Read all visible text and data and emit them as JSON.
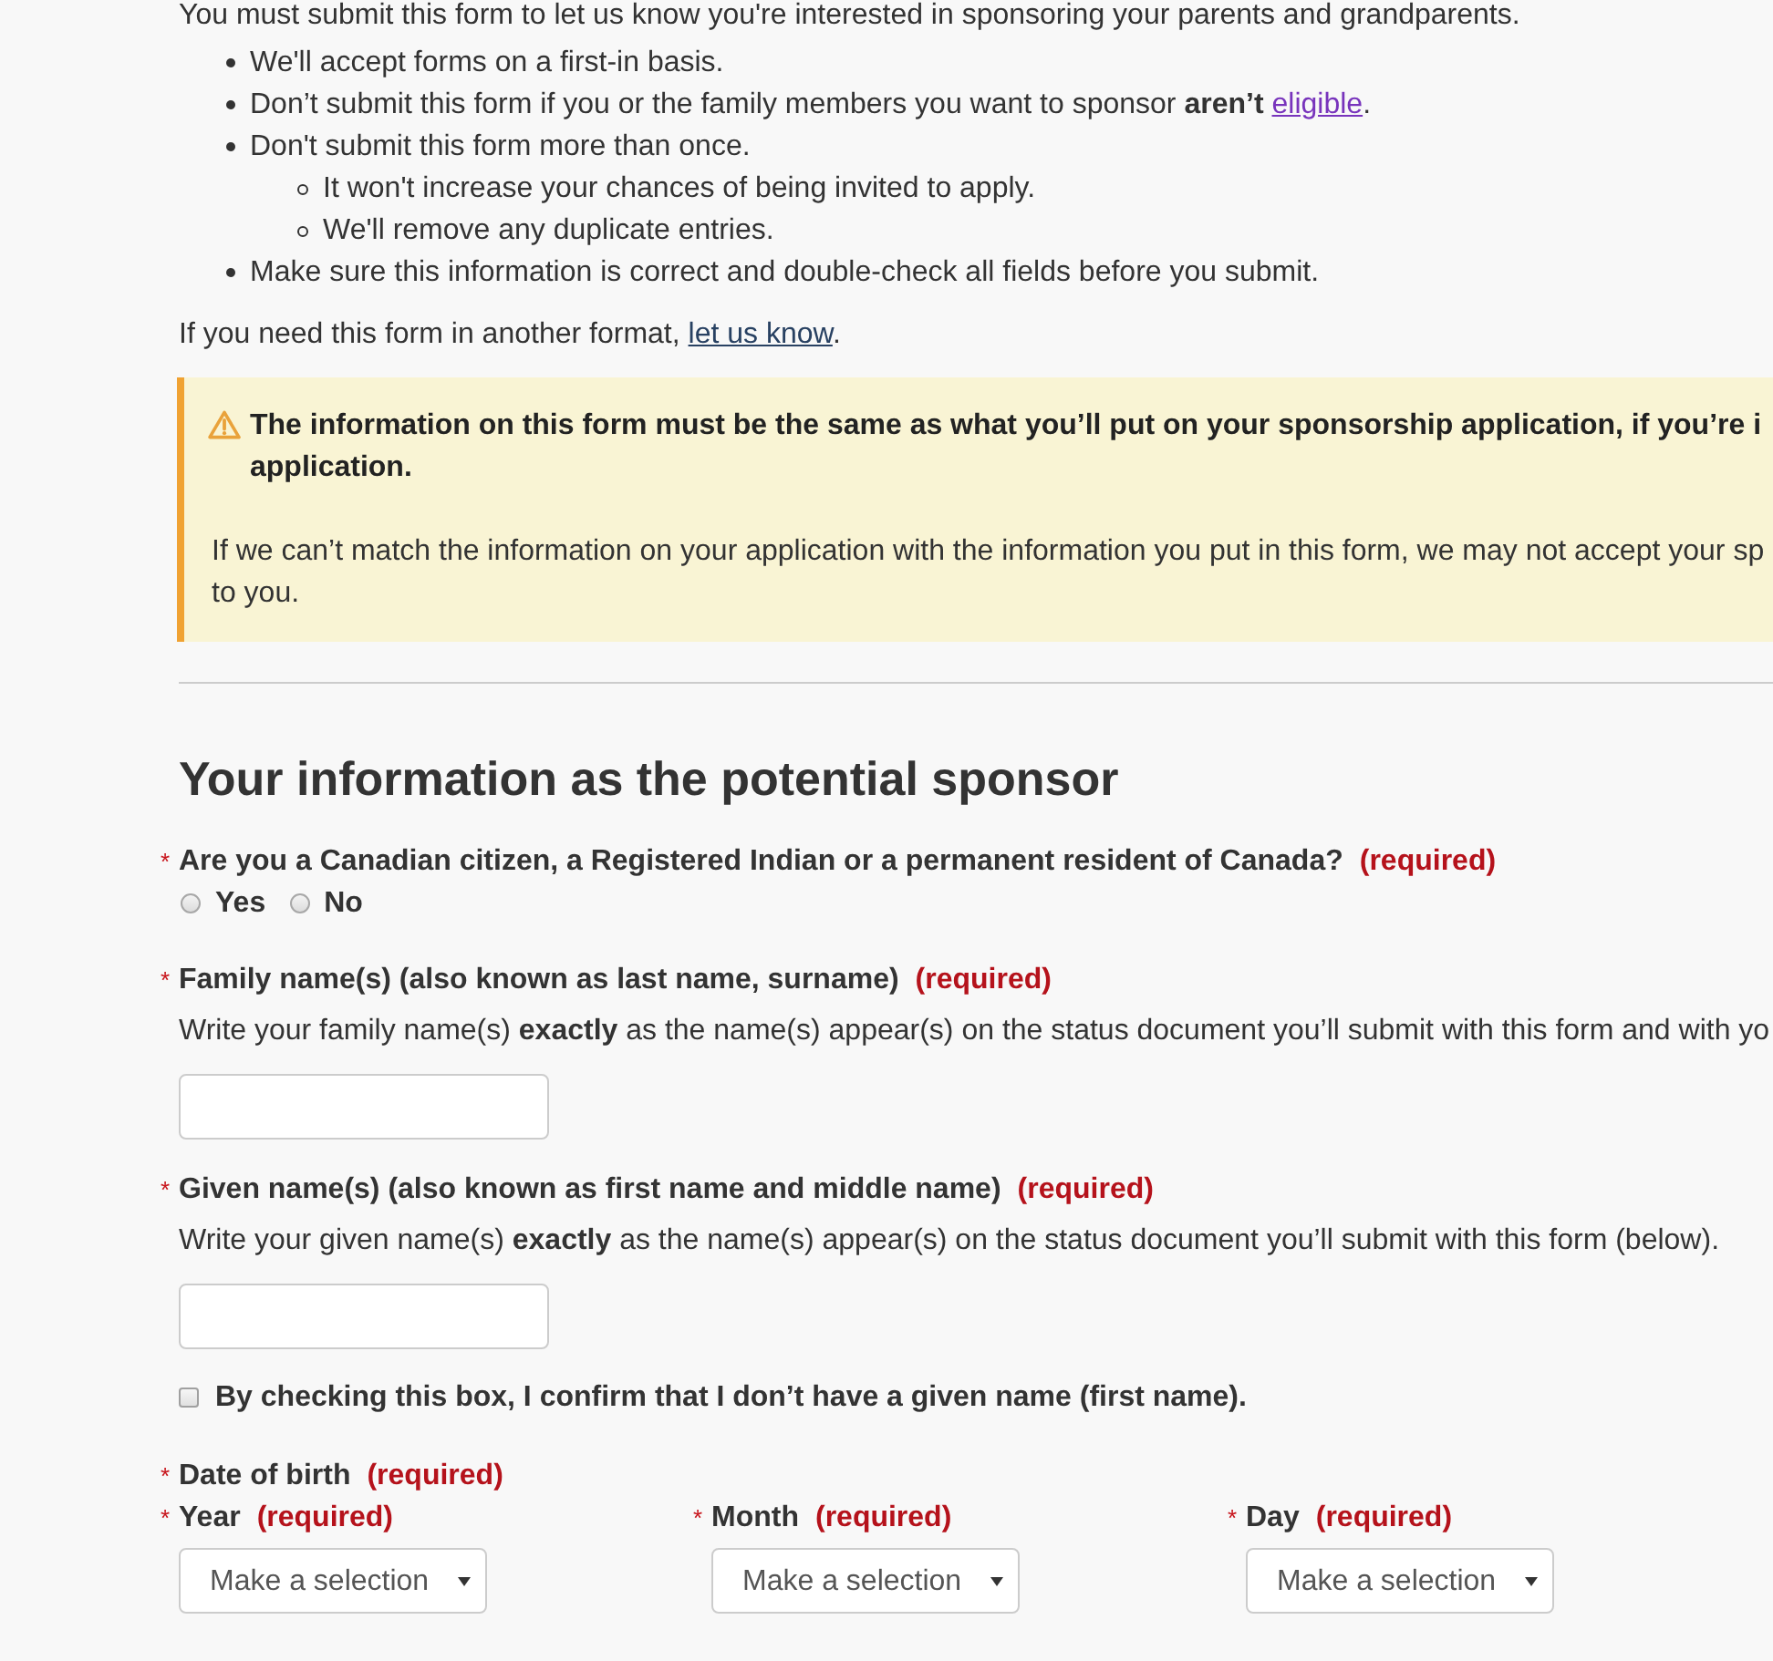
{
  "intro": "You must submit this form to let us know you're interested in sponsoring your parents and grandparents.",
  "bullets": [
    {
      "text": "We'll accept forms on a first-in basis."
    },
    {
      "text": "Don’t submit this form if you or the family members you want to sponsor **aren’t**",
      "link": {
        "text": "eligible",
        "visited": true
      },
      "after": "."
    },
    {
      "text": "Don't submit this form more than once.",
      "children": [
        {
          "text": "It won't increase your chances of being invited to apply."
        },
        {
          "text": "We'll remove any duplicate entries."
        }
      ]
    },
    {
      "text": "Make sure this information is correct and double-check all fields before you submit."
    }
  ],
  "format_note": {
    "text": "If you need this form in another format,",
    "link": {
      "text": "let us know",
      "visited": false
    },
    "after": "."
  },
  "warning": {
    "title_lines": [
      "The information on this form must be the same as what you’ll put on your sponsorship application, if you’re i",
      "application."
    ],
    "body_lines": [
      "If we can’t match the information on your application with the information you put in this form, we may not accept your sp",
      "to you."
    ]
  },
  "section": {
    "heading": "Your information as the potential sponsor",
    "questions": [
      {
        "kind": "radio",
        "asterisk": "*",
        "label": "Are you a Canadian citizen, a Registered Indian or a permanent resident of Canada?",
        "required": "(required)",
        "options": [
          {
            "label": "Yes",
            "selected": false
          },
          {
            "label": "No",
            "selected": false
          }
        ]
      },
      {
        "kind": "text",
        "asterisk": "*",
        "label": "Family name(s) (also known as last name, surname)",
        "required": "(required)",
        "help": "Write your family name(s) **exactly** as the name(s) appear(s) on the status document you’ll submit with this form and with yo"
      },
      {
        "kind": "text",
        "asterisk": "*",
        "label": "Given name(s) (also known as first name and middle name)",
        "required": "(required)",
        "help": "Write your given name(s) **exactly** as the name(s) appear(s) on the status document you’ll submit with this form (below)."
      },
      {
        "kind": "checkbox",
        "label": "By checking this box, I confirm that I don’t have a given name (first name).",
        "checked": false
      },
      {
        "kind": "date",
        "asterisk": "*",
        "label": "Date of birth",
        "required": "(required)",
        "parts": [
          {
            "asterisk": "*",
            "label": "Year",
            "required": "(required)",
            "value": "Make a selection"
          },
          {
            "asterisk": "*",
            "label": "Month",
            "required": "(required)",
            "value": "Make a selection"
          },
          {
            "asterisk": "*",
            "label": "Day",
            "required": "(required)",
            "value": "Make a selection"
          }
        ]
      }
    ]
  }
}
